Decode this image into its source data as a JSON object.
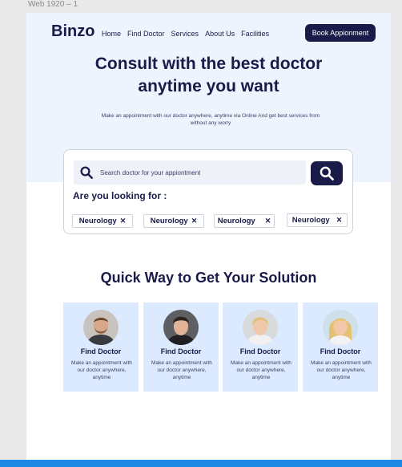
{
  "frame_label": "Web 1920 – 1",
  "brand": {
    "name": "Binzo"
  },
  "nav": {
    "items": [
      "Home",
      "Find Doctor",
      "Services",
      "About Us",
      "Facilities"
    ],
    "cta": "Book Appionment"
  },
  "hero": {
    "title_line1": "Consult with the best doctor",
    "title_line2": "anytime you want",
    "subtitle": "Make an appointment with our doctor anywhere, anytime via Online And get best services from without any worry"
  },
  "search": {
    "placeholder": "Search doctor for your appiontment",
    "looking_for": "Are you looking for :",
    "chips": [
      "Neurology",
      "Neurology",
      "Neurology",
      "Neurology"
    ]
  },
  "section": {
    "title": "Quick Way to Get Your Solution"
  },
  "cards": [
    {
      "title": "Find Doctor",
      "desc": "Make an appointment with our doctor anywhere, anytime"
    },
    {
      "title": "Find Doctor",
      "desc": "Make an appointment with our doctor anywhere, anytime"
    },
    {
      "title": "Find Doctor",
      "desc": "Make an appointment with our doctor anywhere, anytime"
    },
    {
      "title": "Find Doctor",
      "desc": "Make an appointment with our doctor anywhere, anytime"
    }
  ],
  "colors": {
    "primary": "#1a1b48",
    "hero_bg": "#eef4fe",
    "card_bg": "#dbeafe",
    "accent_bar": "#1e88e5"
  }
}
